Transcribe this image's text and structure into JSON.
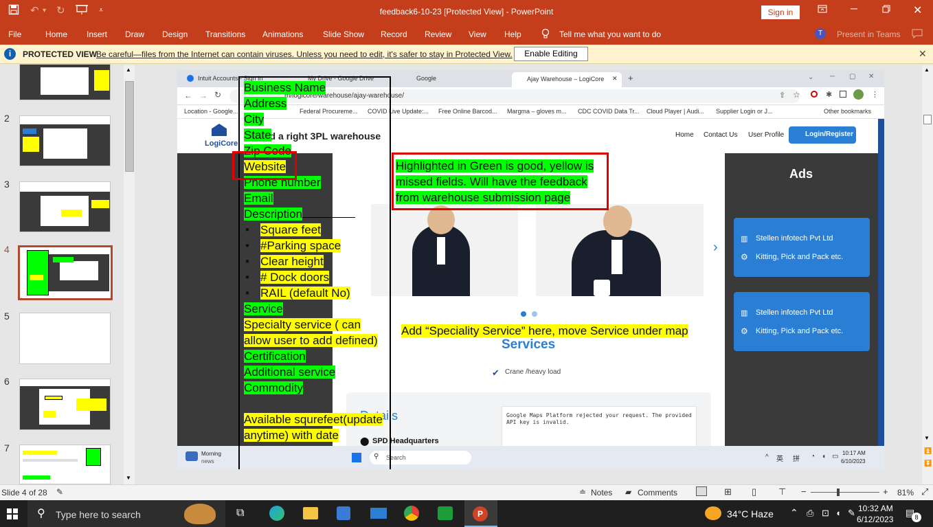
{
  "window": {
    "title": "feedback6-10-23  [Protected View]  -  PowerPoint",
    "sign_in": "Sign in"
  },
  "ribbon_tabs": [
    "File",
    "Home",
    "Insert",
    "Draw",
    "Design",
    "Transitions",
    "Animations",
    "Slide Show",
    "Record",
    "Review",
    "View",
    "Help"
  ],
  "tell_me": "Tell me what you want to do",
  "present_teams": "Present in Teams",
  "protected": {
    "title": "PROTECTED VIEW",
    "message": "Be careful—files from the Internet can contain viruses. Unless you need to edit, it's safer to stay in Protected View.",
    "enable_button": "Enable Editing"
  },
  "slide_numbers": [
    "2",
    "3",
    "4",
    "5",
    "6",
    "7"
  ],
  "browser": {
    "tabs": [
      "Intuit Accounts - Sign In",
      "My Drive - Google Drive",
      "Google",
      "Ajay Warehouse – LogiCore"
    ],
    "url": "m/logicore/warehouse/ajay-warehouse/",
    "bookmarks": [
      "Location - Google...",
      "Federal Procureme...",
      "COVID Live Update:...",
      "Free Online Barcod...",
      "Margma – gloves m...",
      "CDC COVID Data Tr...",
      "Cloud Player | Audi...",
      "Supplier Login or J...",
      "Other bookmarks"
    ]
  },
  "site": {
    "logo": "LogiCore",
    "headline": "nd a right 3PL warehouse",
    "nav": [
      "Home",
      "Contact Us",
      "User Profile"
    ],
    "login": "Login/Register",
    "ads_title": "Ads",
    "ads": [
      {
        "company": "Stellen infotech Pvt Ltd",
        "service": "Kitting, Pick and Pack etc."
      },
      {
        "company": "Stellen infotech Pvt Ltd",
        "service": "Kitting, Pick and Pack etc."
      }
    ],
    "services_title": "Services",
    "service_item": "Crane /heavy load",
    "details_title": "Details",
    "details_item": "SPD Headquarters",
    "map_error": "Google Maps Platform rejected your request. The provided API key is invalid."
  },
  "inner_taskbar": {
    "weather": "Morning",
    "weather_sub": "news",
    "search": "Search",
    "lang1": "英",
    "lang2": "拼",
    "time": "10:17 AM",
    "date": "6/10/2023"
  },
  "fields_list": [
    {
      "text": "Business Name",
      "hl": "g"
    },
    {
      "text": "Address",
      "hl": "g"
    },
    {
      "text": "City",
      "hl": "g"
    },
    {
      "text": "State",
      "hl": "g"
    },
    {
      "text": "Zip Code",
      "hl": "g"
    },
    {
      "text": "Website",
      "hl": "y"
    },
    {
      "text": "Phone number",
      "hl": "g"
    },
    {
      "text": "Email",
      "hl": "g"
    },
    {
      "text": "Description",
      "hl": "g"
    }
  ],
  "bullets": [
    {
      "text": "Square feet",
      "hl": "y"
    },
    {
      "text": "#Parking space",
      "hl": "y"
    },
    {
      "text": "Clear height",
      "hl": "y"
    },
    {
      "text": "# Dock doors",
      "hl": "y"
    },
    {
      "text": "RAIL (default No)",
      "hl": "y"
    }
  ],
  "fields_list2": [
    {
      "text": "Service",
      "hl": "g"
    },
    {
      "text": "Specialty service ( can allow user to add defined)",
      "hl": "y"
    },
    {
      "text": "Certification",
      "hl": "g"
    },
    {
      "text": "Additional service",
      "hl": "g"
    },
    {
      "text": "Commodity",
      "hl": "g"
    }
  ],
  "available_text": "Available squrefeet(update anytime) with date",
  "note_green": "Highlighted in Green is good, yellow is missed fields. Will have the feedback from warehouse submission page",
  "note_yellow": "Add “Speciality Service” here, move Service under map",
  "status": {
    "slide": "Slide 4 of 28",
    "notes": "Notes",
    "comments": "Comments",
    "zoom": "81%"
  },
  "taskbar": {
    "search": "Type here to search",
    "weather": "34°C  Haze",
    "time": "10:32 AM",
    "date": "6/12/2023",
    "notif": "8"
  }
}
